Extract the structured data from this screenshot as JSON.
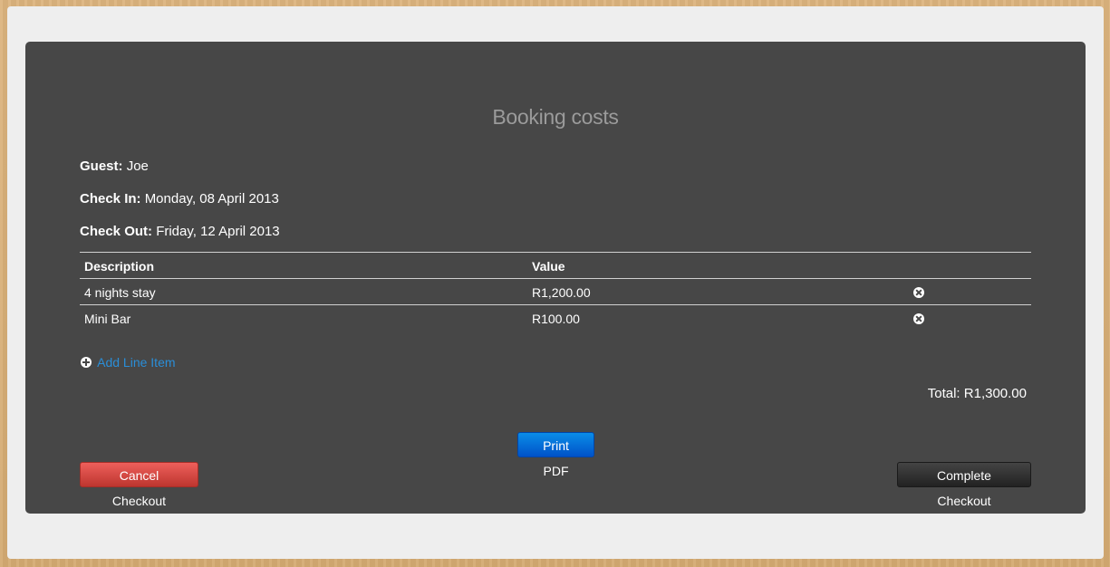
{
  "page": {
    "title": "Booking costs"
  },
  "guest": {
    "label": "Guest:",
    "value": "Joe"
  },
  "check_in": {
    "label": "Check In:",
    "value": "Monday, 08 April 2013"
  },
  "check_out": {
    "label": "Check Out:",
    "value": "Friday, 12 April 2013"
  },
  "table": {
    "headers": {
      "description": "Description",
      "value": "Value"
    },
    "rows": [
      {
        "description": "4 nights stay",
        "value": "R1,200.00",
        "action_icon": "remove-icon"
      },
      {
        "description": "Mini Bar",
        "value": "R100.00",
        "action_icon": "remove-icon"
      }
    ]
  },
  "add_line_item": {
    "label": "Add Line Item",
    "icon": "plus-circle-icon"
  },
  "total": {
    "text": "Total: R1,300.00"
  },
  "buttons": {
    "print_pdf": "Print PDF",
    "cancel_checkout": "Cancel Checkout",
    "complete_checkout": "Complete Checkout"
  },
  "colors": {
    "panel_bg": "#474747",
    "title": "#9b9b9b",
    "link": "#2a8ed8",
    "primary_button": "#0066d6",
    "danger_button": "#da4f49",
    "dark_button": "#333333"
  }
}
